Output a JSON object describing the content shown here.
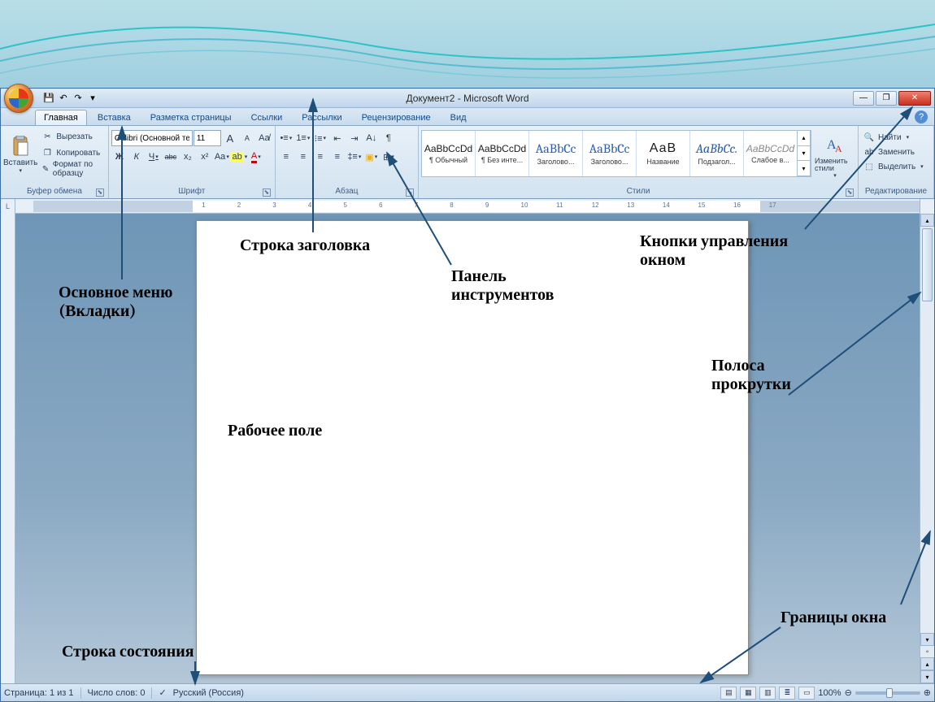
{
  "title": "Документ2 - Microsoft Word",
  "qat": {
    "save": "💾",
    "undo": "↶",
    "redo": "↷"
  },
  "tabs": [
    "Главная",
    "Вставка",
    "Разметка страницы",
    "Ссылки",
    "Рассылки",
    "Рецензирование",
    "Вид"
  ],
  "clipboard": {
    "group_label": "Буфер обмена",
    "paste": "Вставить",
    "cut": "Вырезать",
    "copy": "Копировать",
    "format_painter": "Формат по образцу"
  },
  "font": {
    "group_label": "Шрифт",
    "name": "Calibri (Основной те",
    "size": "11",
    "grow": "A",
    "shrink": "A",
    "clear": "A̶",
    "bold": "Ж",
    "italic": "К",
    "underline": "Ч",
    "strike": "abc",
    "sub": "x₂",
    "sup": "x²",
    "case": "Aa",
    "highlight": "ab",
    "color": "A"
  },
  "paragraph": {
    "group_label": "Абзац",
    "bullets": "≣",
    "numbers": "1≡",
    "multilevel": "⋮≡",
    "dec_indent": "≤",
    "inc_indent": "≥",
    "sort": "A↓",
    "show": "¶",
    "left": "≡",
    "center": "≡",
    "right": "≡",
    "justify": "≡",
    "spacing": "≡",
    "shading": "▦",
    "borders": "⊞"
  },
  "styles": {
    "group_label": "Стили",
    "items": [
      {
        "sample": "AaBbCcDd",
        "name": "¶ Обычный",
        "cls": ""
      },
      {
        "sample": "AaBbCcDd",
        "name": "¶ Без инте...",
        "cls": ""
      },
      {
        "sample": "AaBbCc",
        "name": "Заголово...",
        "cls": "big"
      },
      {
        "sample": "AaBbCc",
        "name": "Заголово...",
        "cls": "big"
      },
      {
        "sample": "АаВ",
        "name": "Название",
        "cls": "title"
      },
      {
        "sample": "AaBbCc.",
        "name": "Подзагол...",
        "cls": "big"
      },
      {
        "sample": "AaBbCcDd",
        "name": "Слабое в...",
        "cls": ""
      }
    ],
    "change_styles": "Изменить стили"
  },
  "editing": {
    "group_label": "Редактирование",
    "find": "Найти",
    "replace": "Заменить",
    "select": "Выделить"
  },
  "status": {
    "page": "Страница: 1 из 1",
    "words": "Число слов: 0",
    "lang": "Русский (Россия)",
    "zoom": "100%"
  },
  "annotations": {
    "title_bar": "Строка заголовка",
    "main_menu": "Основное меню\n(Вкладки)",
    "toolbar": "Панель\nинструментов",
    "window_controls": "Кнопки управления\nокном",
    "scrollbar": "Полоса\nпрокрутки",
    "workarea": "Рабочее поле",
    "window_borders": "Границы окна",
    "status_bar": "Строка состояния"
  }
}
